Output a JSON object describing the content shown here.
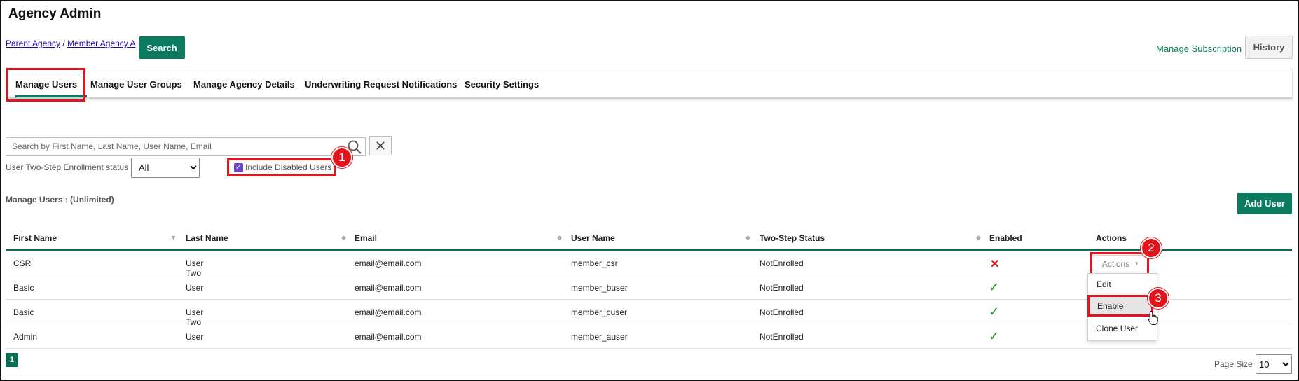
{
  "page": {
    "title": "Agency Admin"
  },
  "breadcrumb": {
    "items": [
      "Parent Agency",
      "Member Agency A"
    ],
    "separator": "/"
  },
  "header": {
    "search_label": "Search",
    "manage_subscription_label": "Manage Subscription",
    "history_label": "History"
  },
  "tabs": [
    {
      "label": "Manage Users",
      "active": true
    },
    {
      "label": "Manage User Groups"
    },
    {
      "label": "Manage Agency Details"
    },
    {
      "label": "Underwriting Request Notifications"
    },
    {
      "label": "Security Settings"
    }
  ],
  "filters": {
    "search_placeholder": "Search by First Name, Last Name, User Name, Email",
    "search_value": "",
    "clear_icon": "close-icon",
    "enrollment_label": "User Two-Step Enrollment status",
    "enrollment_selected": "All",
    "include_disabled_label": "Include Disabled Users",
    "include_disabled_checked": true
  },
  "users_section": {
    "title": "Manage Users : (Unlimited)",
    "add_user_label": "Add User"
  },
  "table": {
    "columns": [
      "First Name",
      "Last Name",
      "Email",
      "User Name",
      "Two-Step Status",
      "Enabled",
      "Actions"
    ],
    "rows": [
      {
        "first": "CSR",
        "last": "User Two",
        "email": "email@email.com",
        "username": "member_csr",
        "status": "NotEnrolled",
        "enabled": false,
        "enabled_symbol": "✕"
      },
      {
        "first": "Basic",
        "last": "User",
        "email": "email@email.com",
        "username": "member_buser",
        "status": "NotEnrolled",
        "enabled": true,
        "enabled_symbol": "✓"
      },
      {
        "first": "Basic",
        "last": "User Two",
        "email": "email@email.com",
        "username": "member_cuser",
        "status": "NotEnrolled",
        "enabled": true,
        "enabled_symbol": "✓"
      },
      {
        "first": "Admin",
        "last": "User",
        "email": "email@email.com",
        "username": "member_auser",
        "status": "NotEnrolled",
        "enabled": true,
        "enabled_symbol": "✓"
      }
    ]
  },
  "actions_dropdown": {
    "button_label": "Actions",
    "items": [
      "Edit",
      "Enable",
      "Clone User"
    ],
    "hovered": "Enable"
  },
  "annotations": [
    "1",
    "2",
    "3"
  ],
  "pagination": {
    "current_page": "1",
    "page_size_label": "Page Size",
    "page_size": "10"
  },
  "colors": {
    "accent": "#0b7a5e",
    "highlight": "#e3141b",
    "checkbox": "#6b47c8",
    "enabled_yes": "#1a8a22",
    "enabled_no": "#dd1111"
  }
}
